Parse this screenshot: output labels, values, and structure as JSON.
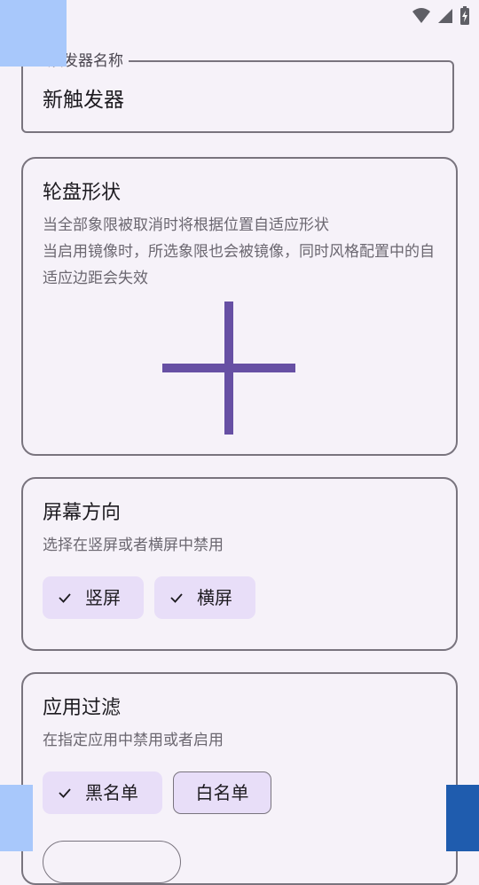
{
  "status_bar": {
    "icons": [
      "wifi-icon",
      "cell-signal-icon",
      "battery-charging-icon"
    ]
  },
  "trigger_name": {
    "label": "触发器名称",
    "value": "新触发器"
  },
  "wheel_shape": {
    "title": "轮盘形状",
    "desc1": "当全部象限被取消时将根据位置自适应形状",
    "desc2": "当启用镜像时，所选象限也会被镜像，同时风格配置中的自适应边距会失效"
  },
  "orientation": {
    "title": "屏幕方向",
    "desc": "选择在竖屏或者横屏中禁用",
    "chips": [
      {
        "label": "竖屏",
        "selected": true
      },
      {
        "label": "横屏",
        "selected": true
      }
    ]
  },
  "app_filter": {
    "title": "应用过滤",
    "desc": "在指定应用中禁用或者启用",
    "chips": [
      {
        "label": "黑名单",
        "selected": true
      },
      {
        "label": "白名单",
        "selected": false
      }
    ]
  },
  "colors": {
    "accent": "#6750a4",
    "chip_bg": "#e8def8",
    "outline": "#79747e",
    "background": "#f6f2f9"
  }
}
